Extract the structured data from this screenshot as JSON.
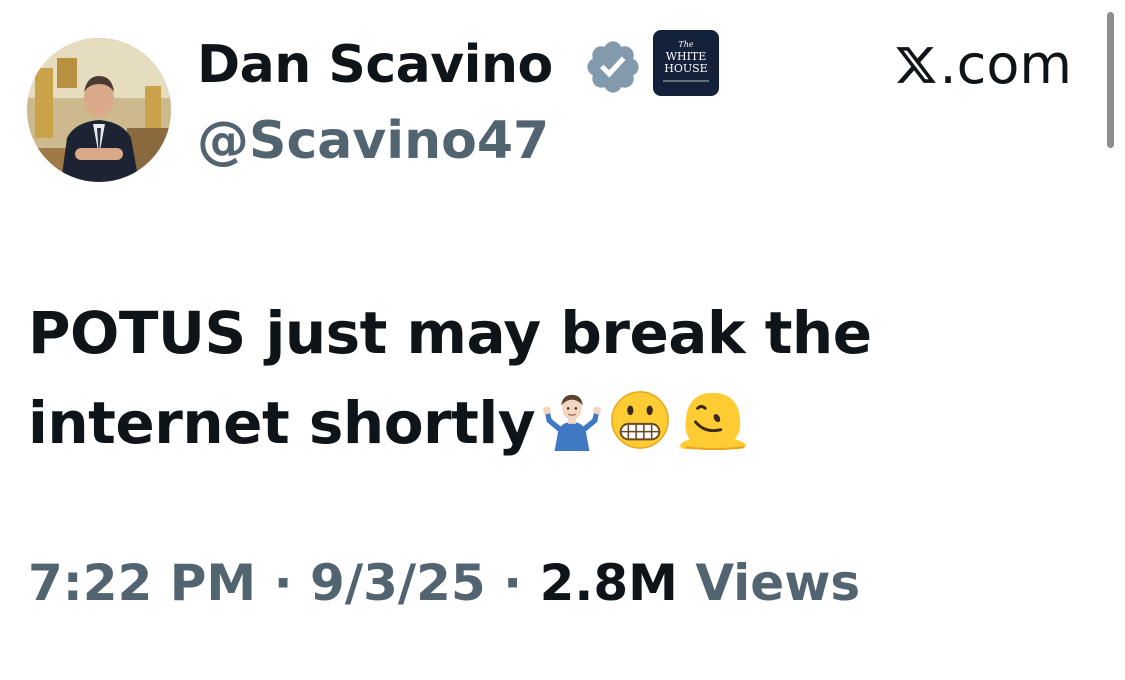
{
  "author": {
    "display_name": "Dan Scavino",
    "handle": "@Scavino47",
    "verified_badge_color": "#829aab",
    "affiliate_badge": {
      "line1": "The",
      "line2": "WHITE",
      "line3": "HOUSE",
      "background": "#14213a"
    }
  },
  "source": {
    "label": ".com",
    "logo_icon": "x-logo-icon"
  },
  "tweet": {
    "line1": "POTUS just may break the",
    "line2": "internet shortly",
    "emojis": [
      "person-shrugging-icon",
      "grimacing-face-icon",
      "melting-face-icon"
    ]
  },
  "meta": {
    "time": "7:22 PM",
    "separator": "·",
    "date": "9/3/25",
    "views_count": "2.8M",
    "views_label": "Views"
  },
  "colors": {
    "text_primary": "#0f1419",
    "text_secondary": "#536471"
  }
}
